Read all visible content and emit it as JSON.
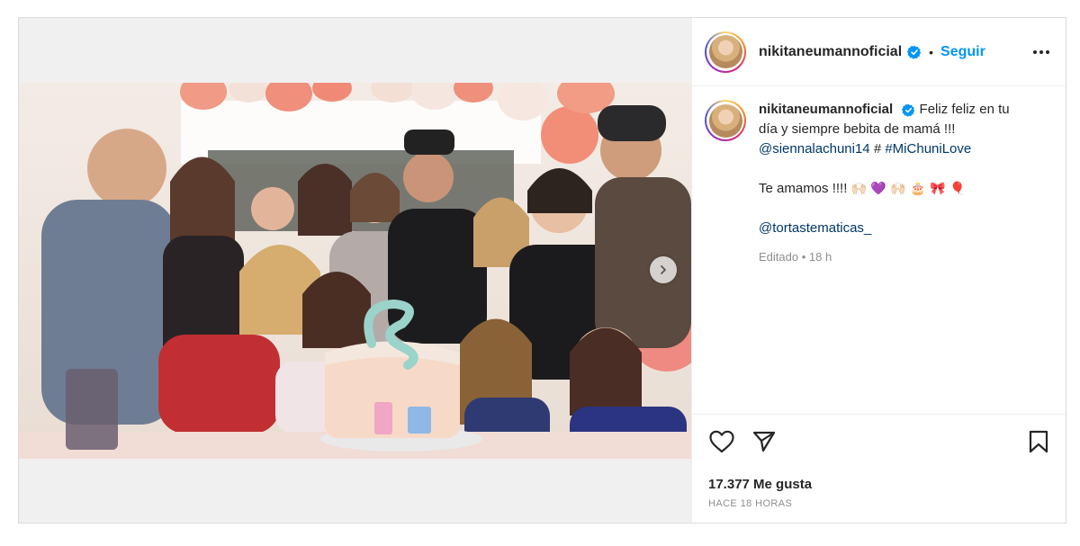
{
  "post": {
    "username": "nikitaneumannoficial",
    "follow_label": "Seguir",
    "separator": "•",
    "caption_line1": "Feliz feliz en tu día y siempre bebita de mamá !!!",
    "mention1": "@siennalachuni14",
    "hash_sep": "#",
    "hashtag": "#MiChuniLove",
    "caption_line2": "Te amamos !!!!",
    "emojis": "🙌🏻 💜 🙌🏻 🎂 🎀 🎈",
    "mention2": "@tortastematicas_",
    "edited_meta": "Editado • 18 h",
    "likes": "17.377 Me gusta",
    "timestamp": "HACE 18 HORAS"
  },
  "colors": {
    "accent": "#0095f6",
    "link": "#00376b",
    "muted": "#8e8e8e",
    "verified": "#0095f6"
  },
  "icons": {
    "verified": "verified-badge-icon",
    "more": "more-options-icon",
    "like": "heart-icon",
    "share": "paper-plane-icon",
    "save": "bookmark-icon",
    "next": "chevron-right-icon"
  }
}
